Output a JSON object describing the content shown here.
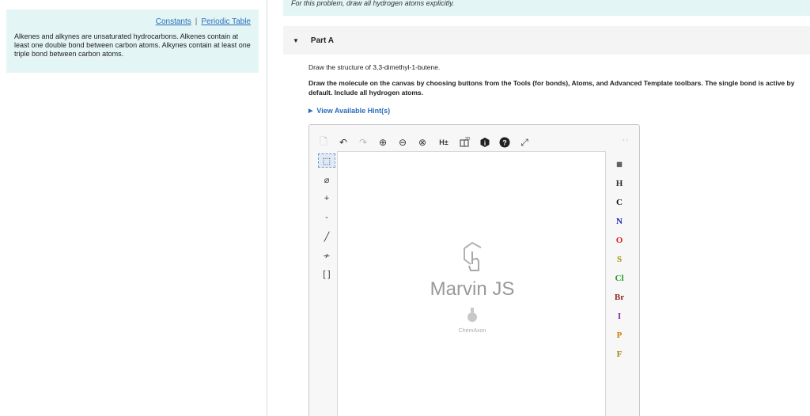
{
  "left_panel": {
    "links": {
      "constants": "Constants",
      "separator": "|",
      "periodic_table": "Periodic Table"
    },
    "text": "Alkenes and alkynes are unsaturated hydrocarbons. Alkenes contain at least one double bond between carbon atoms. Alkynes contain at least one triple bond between carbon atoms."
  },
  "banner": {
    "text": "For this problem, draw all hydrogen atoms explicitly."
  },
  "part": {
    "arrow": "▼",
    "label": "Part A"
  },
  "question": {
    "prompt": "Draw the structure of 3,3-dimethyl-1-butene.",
    "instructions": "Draw the molecule on the canvas by choosing buttons from the Tools (for bonds), Atoms, and Advanced Template toolbars. The single bond is active by default. Include all hydrogen atoms."
  },
  "hints": {
    "arrow": "▶",
    "label": "View Available Hint(s)"
  },
  "editor": {
    "top_toolbar": {
      "new": "🗋",
      "undo": "↶",
      "redo": "↷",
      "zoom_in": "⊕",
      "zoom_out": "⊖",
      "zoom_reset": "⊗",
      "hydrogens": "H±",
      "clean_2d": "2D",
      "info": "i",
      "help": "?",
      "fullscreen": "⤢"
    },
    "nav_arrows": "‹ ›",
    "left_toolbar": {
      "select": "⬚",
      "erase": "⌀",
      "charge_plus": "+",
      "charge_minus": "-",
      "single_bond": "╱",
      "chain": "≁",
      "bracket": "[ ]"
    },
    "watermark": {
      "name": "Marvin JS",
      "sub": "ChemAxon"
    },
    "atoms": [
      {
        "symbol": "H",
        "color": "#333333"
      },
      {
        "symbol": "C",
        "color": "#111111"
      },
      {
        "symbol": "N",
        "color": "#2020c8"
      },
      {
        "symbol": "O",
        "color": "#e02020"
      },
      {
        "symbol": "S",
        "color": "#a08a00"
      },
      {
        "symbol": "Cl",
        "color": "#1a9a1a"
      },
      {
        "symbol": "Br",
        "color": "#8a2a20"
      },
      {
        "symbol": "I",
        "color": "#8a20a0"
      },
      {
        "symbol": "P",
        "color": "#d07a00"
      },
      {
        "symbol": "F",
        "color": "#a08a00"
      }
    ]
  }
}
